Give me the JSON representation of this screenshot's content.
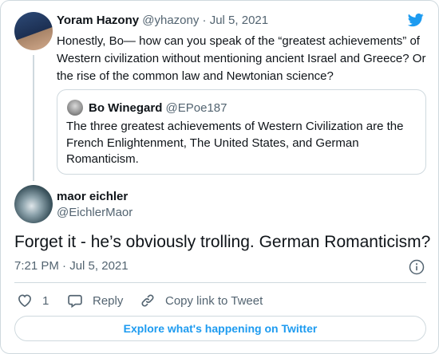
{
  "tweet": {
    "author_name": "Yoram Hazony",
    "author_handle": "@yhazony",
    "separator": "·",
    "date": "Jul 5, 2021",
    "text": "Honestly, Bo— how can you speak of the “greatest achievements” of Western civilization without mentioning ancient Israel and Greece? Or the rise of the common law and Newtonian science?"
  },
  "quote": {
    "author_name": "Bo Winegard",
    "author_handle": "@EPoe187",
    "text": "The three greatest achievements of Western Civilization are the French Enlightenment, The United States, and German Romanticism."
  },
  "reply": {
    "author_name": "maor eichler",
    "author_handle": "@EichlerMaor",
    "text": "Forget it - he’s obviously trolling. German Romanticism?",
    "time": "7:21 PM",
    "separator": "·",
    "date": "Jul 5, 2021"
  },
  "actions": {
    "like_count": "1",
    "reply_label": "Reply",
    "copy_link_label": "Copy link to Tweet"
  },
  "explore_label": "Explore what's happening on Twitter",
  "icons": {
    "brand": "twitter-bird-icon",
    "info": "info-icon",
    "like": "heart-icon",
    "reply": "speech-bubble-icon",
    "copy": "link-icon"
  },
  "colors": {
    "accent": "#1d9bf0",
    "text": "#0f1419",
    "secondary": "#536471",
    "border": "#cfd9de"
  }
}
